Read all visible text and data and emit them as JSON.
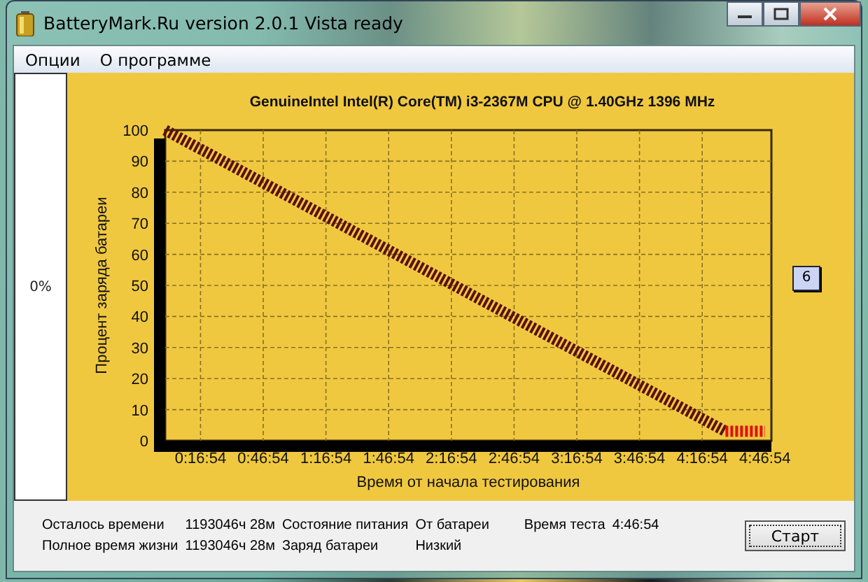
{
  "window": {
    "title": "BatteryMark.Ru version 2.0.1 Vista ready"
  },
  "menu": [
    {
      "label": "Опции"
    },
    {
      "label": "О программе"
    }
  ],
  "left_panel": {
    "reading": "0%"
  },
  "chart": {
    "chart_data": {
      "type": "line",
      "title": "GenuineIntel Intel(R) Core(TM) i3-2367M CPU @ 1.40GHz 1396 MHz",
      "xlabel": "Время от начала тестирования",
      "ylabel": "Процент заряда батареи",
      "x": [
        0,
        268,
        287
      ],
      "series": [
        {
          "color": "#5a1010",
          "line_style": "dashed",
          "values": [
            100,
            3,
            null
          ]
        },
        {
          "color": "#e01010",
          "line_style": "dashed",
          "values": [
            null,
            3,
            3
          ]
        }
      ],
      "grid": true,
      "xlim": [
        0,
        290
      ],
      "ylim": [
        0,
        100
      ],
      "xticks": [
        {
          "value": 16.9,
          "label": "0:16:54"
        },
        {
          "value": 46.9,
          "label": "0:46:54"
        },
        {
          "value": 76.9,
          "label": "1:16:54"
        },
        {
          "value": 106.9,
          "label": "1:46:54"
        },
        {
          "value": 136.9,
          "label": "2:16:54"
        },
        {
          "value": 166.9,
          "label": "2:46:54"
        },
        {
          "value": 196.9,
          "label": "3:16:54"
        },
        {
          "value": 226.9,
          "label": "3:46:54"
        },
        {
          "value": 256.9,
          "label": "4:16:54"
        },
        {
          "value": 286.9,
          "label": "4:46:54"
        }
      ],
      "yticks": [
        0,
        10,
        20,
        30,
        40,
        50,
        60,
        70,
        80,
        90,
        100
      ]
    }
  },
  "badge": "6",
  "status": [
    {
      "label": "Осталось времени",
      "value": "1193046ч 28м"
    },
    {
      "label": "Полное время жизни",
      "value": "1193046ч 28м"
    }
  ],
  "power": [
    {
      "label": "Состояние питания",
      "value": "От батареи"
    },
    {
      "label": "Заряд батареи",
      "value": "Низкий"
    }
  ],
  "test_time": {
    "label": "Время теста",
    "value": "4:46:54"
  },
  "start_button": "Старт"
}
